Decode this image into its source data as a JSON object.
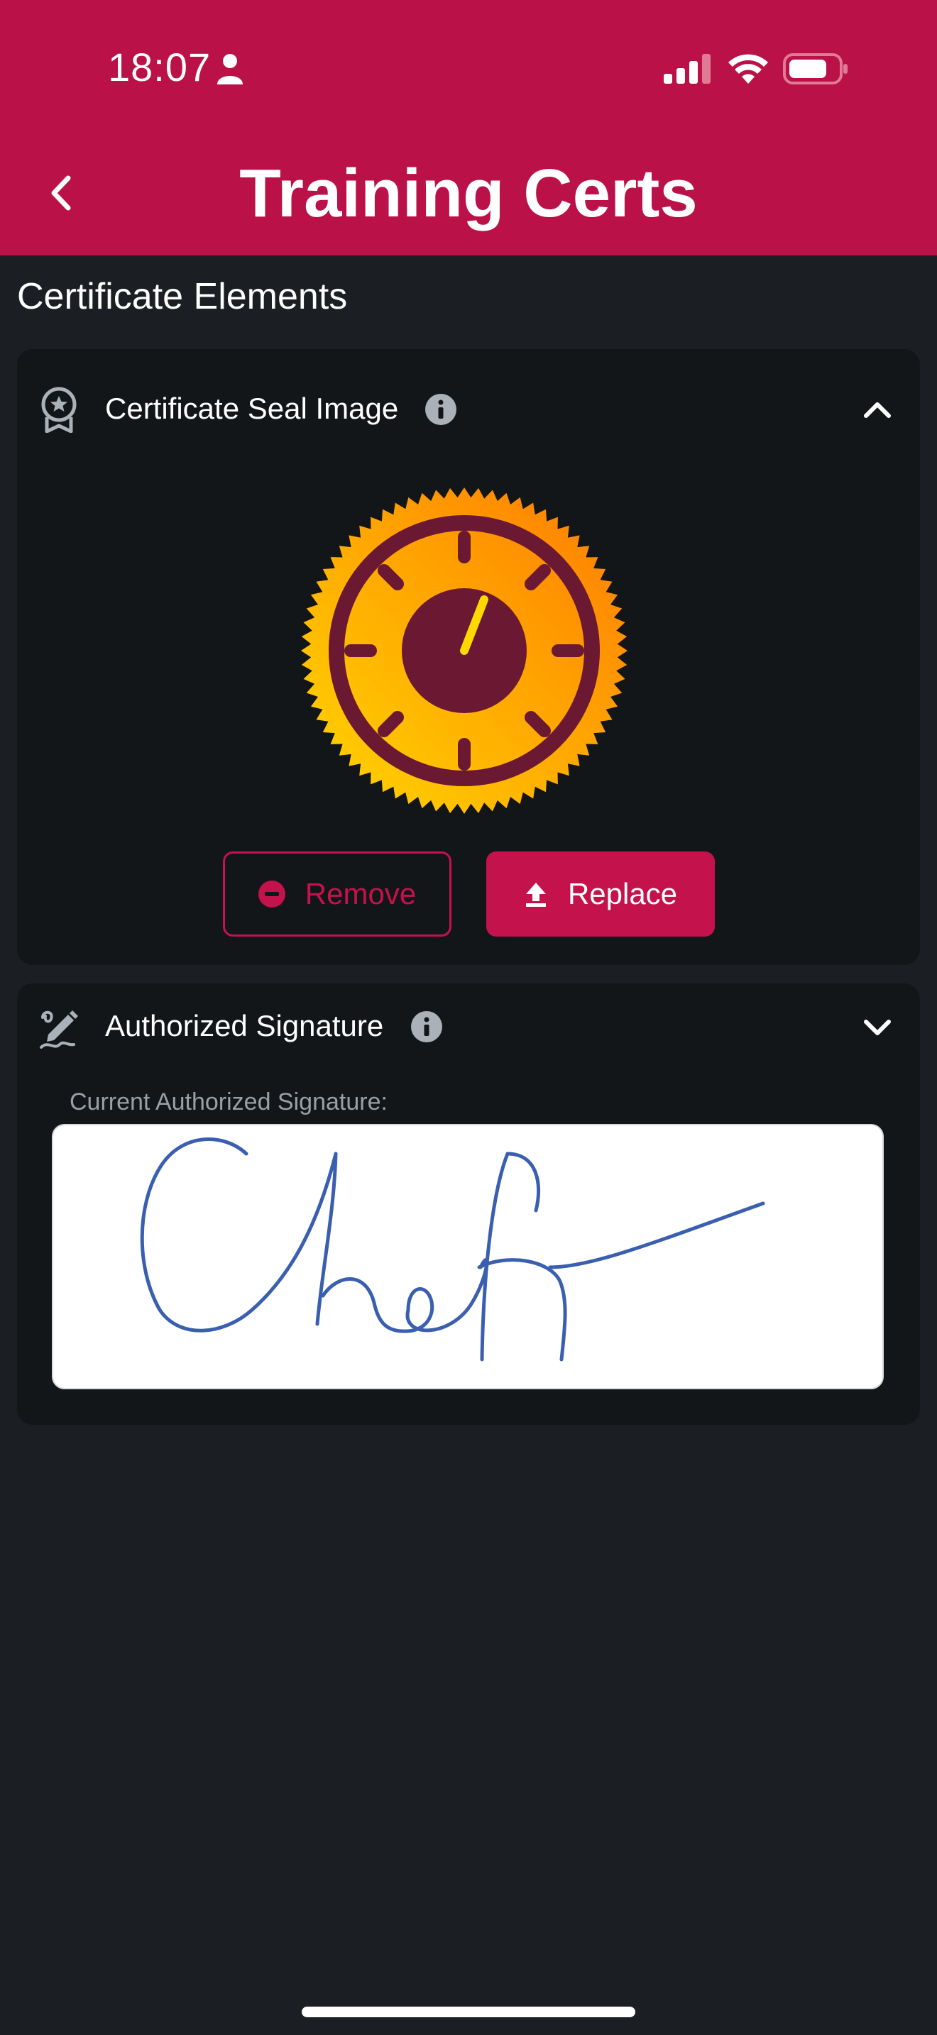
{
  "status_bar": {
    "time": "18:07",
    "icons": [
      "person-icon",
      "signal-icon",
      "wifi-icon",
      "battery-icon"
    ]
  },
  "header": {
    "title": "Training Certs",
    "back_icon": "chevron-left-icon",
    "background_color": "#bb1149"
  },
  "section": {
    "title": "Certificate Elements"
  },
  "seal_card": {
    "icon": "award-ribbon-icon",
    "title": "Certificate Seal Image",
    "info_icon": "info-icon",
    "chevron": "chevron-up-icon",
    "expanded": true,
    "image": "certificate-seal-stopwatch",
    "buttons": {
      "remove_label": "Remove",
      "replace_label": "Replace"
    }
  },
  "signature_card": {
    "icon": "signature-pen-icon",
    "title": "Authorized Signature",
    "info_icon": "info-icon",
    "chevron": "chevron-down-icon",
    "caption": "Current Authorized Signature:",
    "signature_text": "Chief"
  },
  "colors": {
    "accent": "#c4124d",
    "background": "#1b1e22",
    "card": "#131619",
    "signature_ink": "#3a5fb0"
  }
}
